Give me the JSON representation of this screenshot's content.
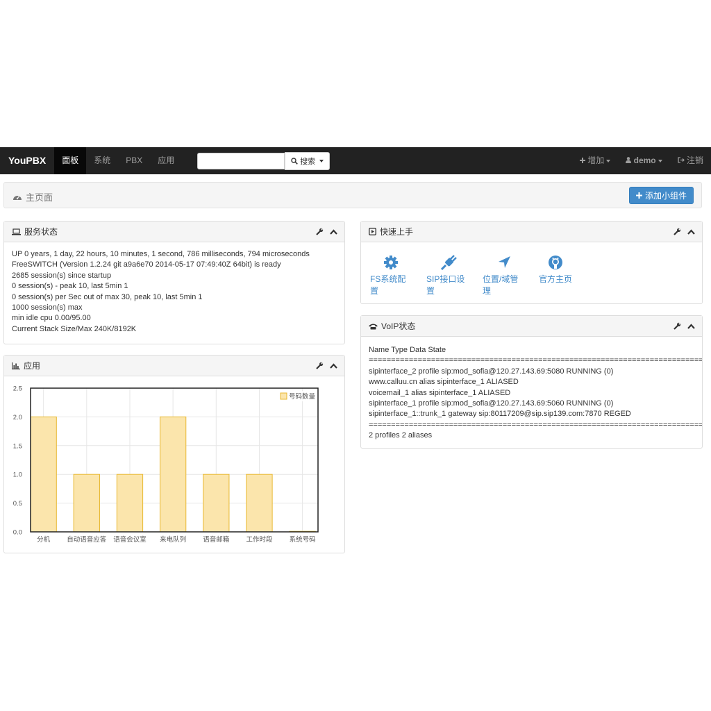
{
  "navbar": {
    "brand": "YouPBX",
    "items": [
      "面板",
      "系统",
      "PBX",
      "应用"
    ],
    "search_button": "搜索",
    "search_placeholder": "",
    "add_label": "增加",
    "user_label": "demo",
    "logout_label": "注销"
  },
  "page_header": {
    "title": "主页面",
    "add_widget_label": "添加小组件"
  },
  "status_panel": {
    "title": "服务状态",
    "lines": [
      "UP 0 years, 1 day, 22 hours, 10 minutes, 1 second, 786 milliseconds, 794 microseconds",
      "FreeSWITCH (Version 1.2.24 git a9a6e70 2014-05-17 07:49:40Z 64bit) is ready",
      "2685 session(s) since startup",
      "0 session(s) - peak 10, last 5min 1",
      "0 session(s) per Sec out of max 30, peak 10, last 5min 1",
      "1000 session(s) max",
      "min idle cpu 0.00/95.00",
      "Current Stack Size/Max 240K/8192K"
    ]
  },
  "quick_panel": {
    "title": "快速上手",
    "items": [
      {
        "label": "FS系统配置",
        "icon": "gear-icon"
      },
      {
        "label": "SIP接口设置",
        "icon": "plug-icon"
      },
      {
        "label": "位置/域管理",
        "icon": "location-arrow-icon"
      },
      {
        "label": "官方主页",
        "icon": "github-icon"
      }
    ]
  },
  "voip_panel": {
    "title": "VoIP状态",
    "header_line": "Name Type Data State",
    "separator": "=====================================================================================================",
    "rows": [
      "sipinterface_2 profile sip:mod_sofia@120.27.143.69:5080 RUNNING (0)",
      "www.calluu.cn alias sipinterface_1 ALIASED",
      "voicemail_1 alias sipinterface_1 ALIASED",
      "sipinterface_1 profile sip:mod_sofia@120.27.143.69:5060 RUNNING (0)",
      "sipinterface_1::trunk_1 gateway sip:80117209@sip.sip139.com:7870 REGED"
    ],
    "footer_line": "2 profiles 2 aliases"
  },
  "app_panel": {
    "title": "应用"
  },
  "colors": {
    "navbar": "#222222",
    "accent": "#428bca",
    "bar_fill": "#fbe5ac",
    "bar_stroke": "#e8b830"
  },
  "chart_data": {
    "type": "bar",
    "categories": [
      "分机",
      "自动语音应答",
      "语音会议室",
      "来电队列",
      "语音邮箱",
      "工作时段",
      "系统号码"
    ],
    "series": [
      {
        "name": "号码数量",
        "values": [
          2,
          1,
          1,
          2,
          1,
          1,
          0
        ]
      }
    ],
    "title": "",
    "xlabel": "",
    "ylabel": "",
    "ylim": [
      0,
      2.5
    ],
    "yticks": [
      "0.0",
      "0.5",
      "1.0",
      "1.5",
      "2.0",
      "2.5"
    ],
    "grid": true,
    "legend": "top-right"
  }
}
